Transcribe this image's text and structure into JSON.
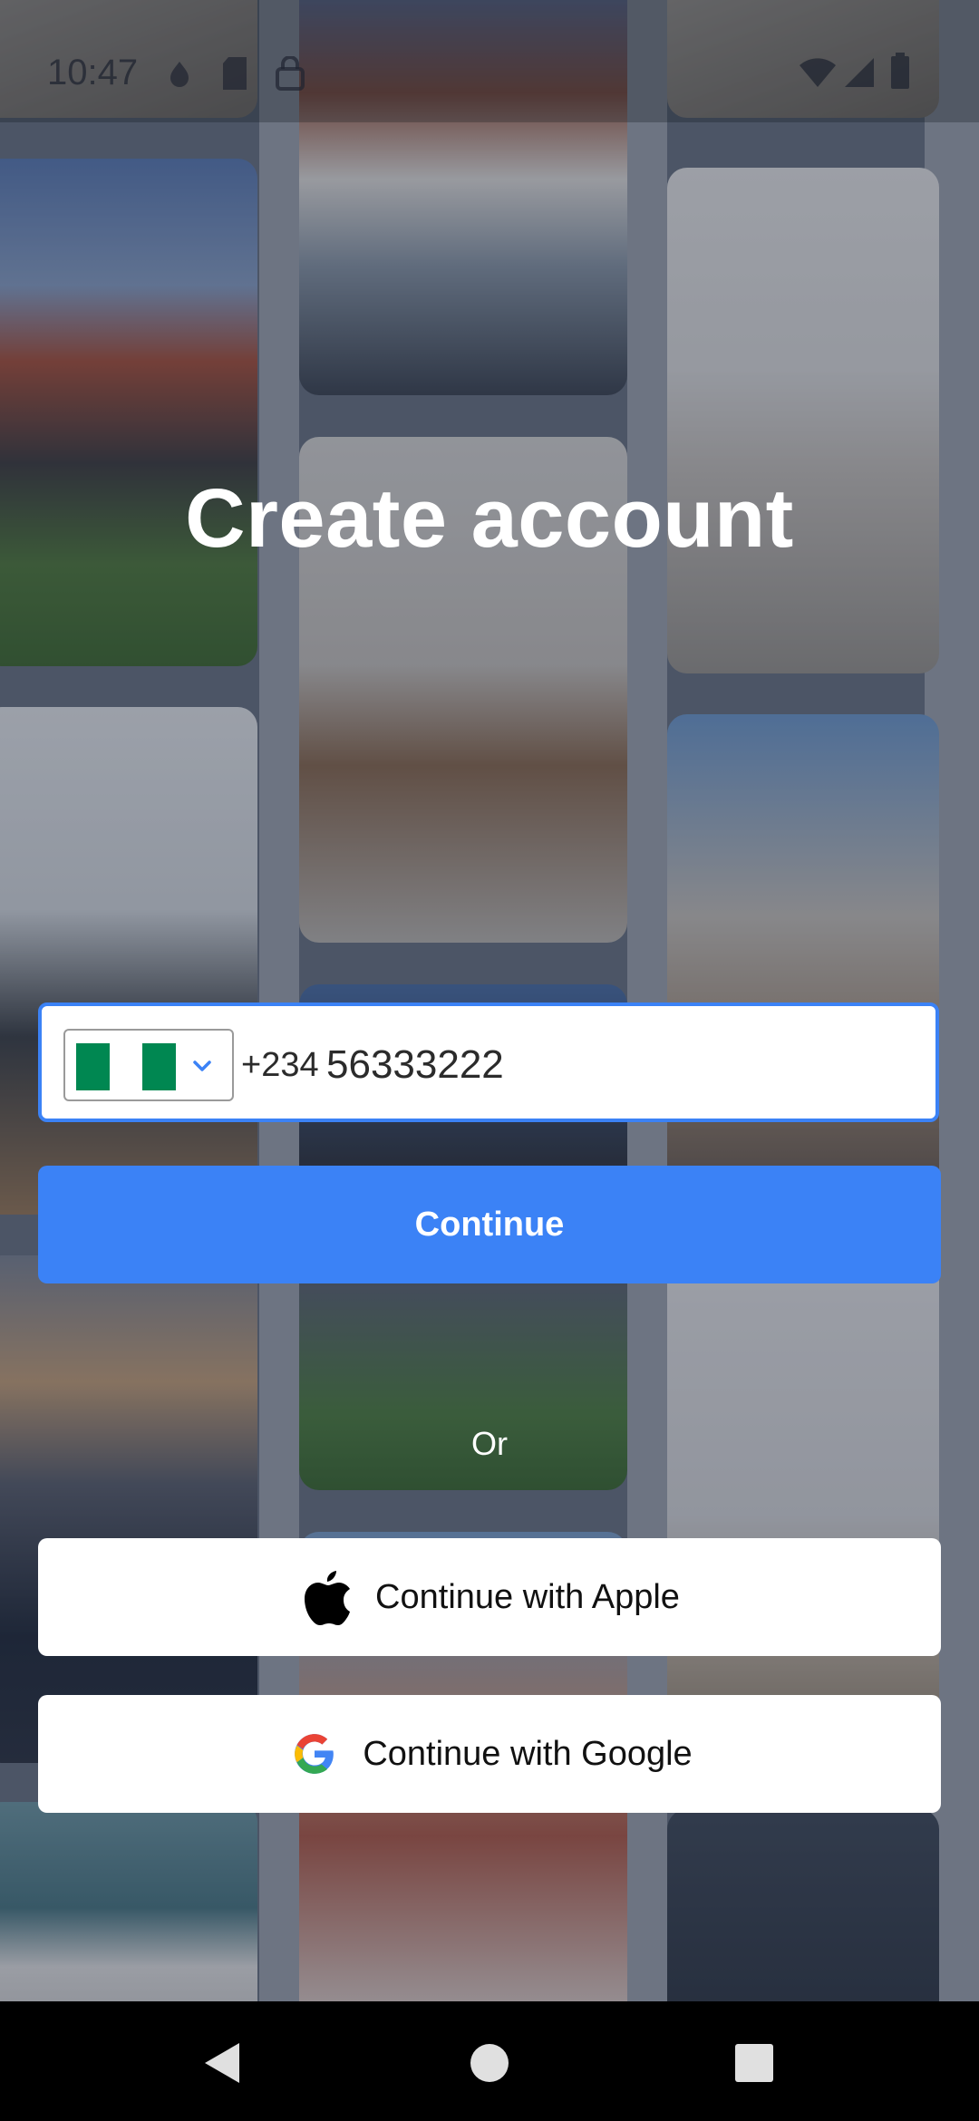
{
  "status_bar": {
    "time": "10:47",
    "icons_left": [
      "notification-icon",
      "sim-card-icon",
      "vpn-icon"
    ],
    "icons_right": [
      "wifi-icon",
      "signal-icon",
      "battery-icon"
    ]
  },
  "title": "Create account",
  "phone": {
    "country_flag": "nigeria-flag-icon",
    "flag_colors": [
      "#008751",
      "#ffffff",
      "#008751"
    ],
    "dial_code": "+234",
    "value": "56333222"
  },
  "continue_label": "Continue",
  "or_label": "Or",
  "apple_label": "Continue with Apple",
  "google_label": "Continue with Google",
  "colors": {
    "accent": "#3b82f6",
    "title_text": "#ffffff"
  },
  "nav": [
    "back-icon",
    "home-icon",
    "recents-icon"
  ]
}
